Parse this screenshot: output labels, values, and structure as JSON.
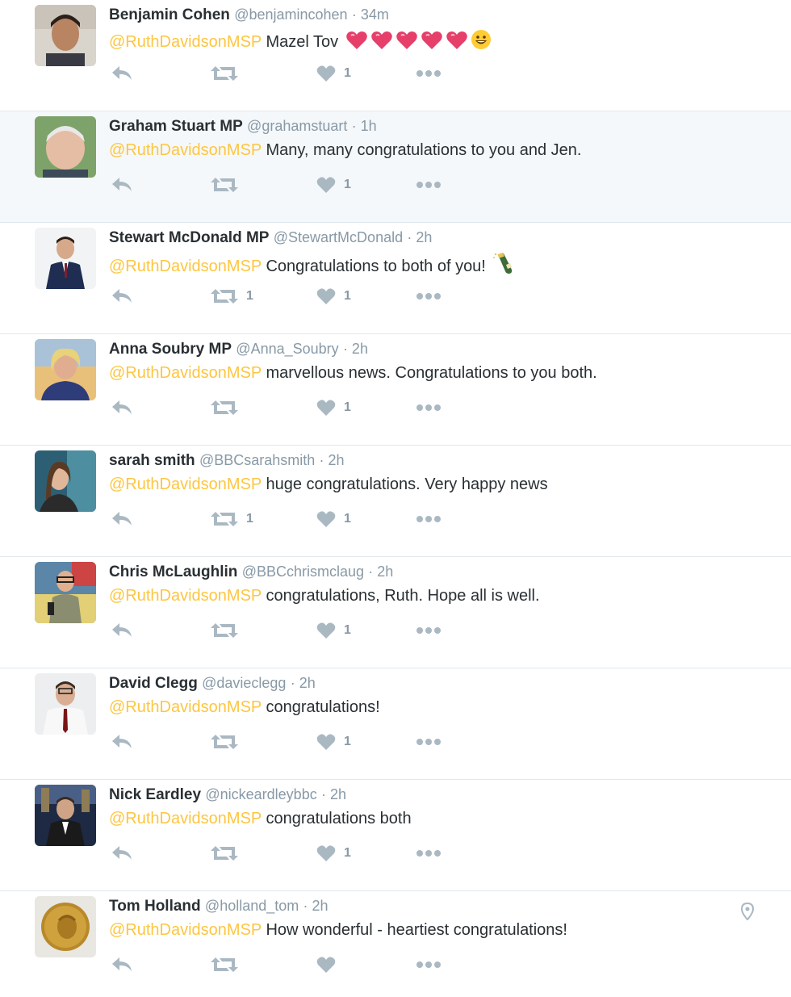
{
  "colors": {
    "mention": "#fdc640",
    "name": "#292f33",
    "meta": "#8899a6",
    "icon": "#aab8c2",
    "highlight": "#f5f8fa"
  },
  "tweets": [
    {
      "name": "Benjamin Cohen",
      "handle": "@benjamincohen",
      "time": "· 34m",
      "mention": "@RuthDavidsonMSP",
      "text": " Mazel Tov ",
      "retweets": "",
      "likes": "1",
      "emoji": "hearts-smile"
    },
    {
      "name": "Graham Stuart MP",
      "handle": "@grahamstuart",
      "time": "· 1h",
      "mention": "@RuthDavidsonMSP",
      "text": " Many, many congratulations to you and Jen.",
      "retweets": "",
      "likes": "1",
      "highlighted": true
    },
    {
      "name": "Stewart McDonald MP",
      "handle": "@StewartMcDonald",
      "time": "· 2h",
      "mention": "@RuthDavidsonMSP",
      "text": " Congratulations to both of you! ",
      "retweets": "1",
      "likes": "1",
      "emoji": "bottle"
    },
    {
      "name": "Anna Soubry MP",
      "handle": "@Anna_Soubry",
      "time": "· 2h",
      "mention": "@RuthDavidsonMSP",
      "text": " marvellous news. Congratulations to you both.",
      "retweets": "",
      "likes": "1"
    },
    {
      "name": "sarah smith",
      "handle": "@BBCsarahsmith",
      "time": "· 2h",
      "mention": "@RuthDavidsonMSP",
      "text": " huge congratulations. Very happy news",
      "retweets": "1",
      "likes": "1"
    },
    {
      "name": "Chris McLaughlin",
      "handle": "@BBCchrismclaug",
      "time": "· 2h",
      "mention": "@RuthDavidsonMSP",
      "text": " congratulations, Ruth. Hope all is well.",
      "retweets": "",
      "likes": "1"
    },
    {
      "name": "David Clegg",
      "handle": "@davieclegg",
      "time": "· 2h",
      "mention": "@RuthDavidsonMSP",
      "text": " congratulations!",
      "retweets": "",
      "likes": "1"
    },
    {
      "name": "Nick Eardley",
      "handle": "@nickeardleybbc",
      "time": "· 2h",
      "mention": "@RuthDavidsonMSP",
      "text": " congratulations both",
      "retweets": "",
      "likes": "1"
    },
    {
      "name": "Tom Holland",
      "handle": "@holland_tom",
      "time": "· 2h",
      "mention": "@RuthDavidsonMSP",
      "text": " How wonderful - heartiest congratulations!",
      "retweets": "",
      "likes": "",
      "location_icon": "map-pin-icon"
    }
  ]
}
